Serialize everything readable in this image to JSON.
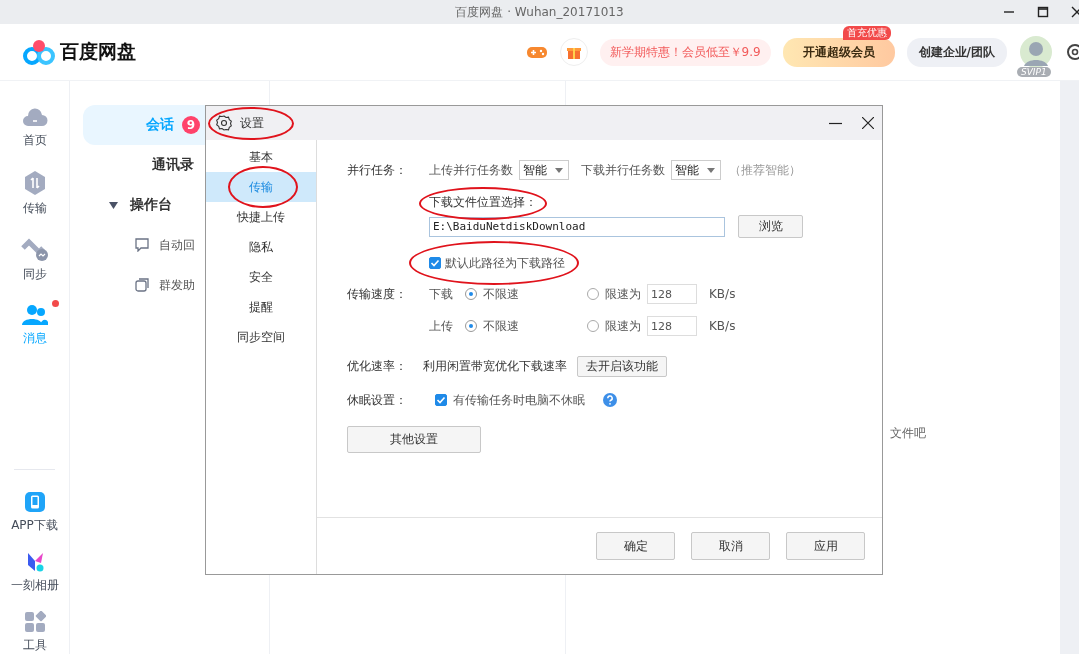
{
  "window": {
    "title": "百度网盘 · Wuhan_20171013"
  },
  "header": {
    "logo": "百度网盘",
    "promo": "新学期特惠！会员低至￥9.9",
    "vip_button": "开通超级会员",
    "vip_badge": "首充优惠",
    "team_button": "创建企业/团队",
    "avatar_badge": "SVIP1"
  },
  "nav": {
    "items": [
      {
        "kind": "home",
        "label": "首页",
        "selected": false,
        "notification": false
      },
      {
        "kind": "transfer",
        "label": "传输",
        "selected": false,
        "notification": false
      },
      {
        "kind": "sync",
        "label": "同步",
        "selected": false,
        "notification": false
      },
      {
        "kind": "message",
        "label": "消息",
        "selected": true,
        "notification": true
      }
    ],
    "bottom": [
      {
        "kind": "app",
        "label": "APP下载"
      },
      {
        "kind": "album",
        "label": "一刻相册"
      },
      {
        "kind": "tools",
        "label": "工具"
      }
    ]
  },
  "messages": {
    "items": [
      {
        "label": "会话",
        "selected": true,
        "badge": "9"
      },
      {
        "label": "通讯录",
        "selected": false
      },
      {
        "label": "操作台",
        "selected": false,
        "expanded": true,
        "children": [
          {
            "kind": "auto-reply",
            "label": "自动回"
          },
          {
            "kind": "broadcast",
            "label": "群发助"
          }
        ]
      }
    ]
  },
  "background_text": "文件吧",
  "dialog": {
    "title": "设置",
    "title_circled": true,
    "menu": [
      {
        "label": "基本",
        "selected": false,
        "circled": false
      },
      {
        "label": "传输",
        "selected": true,
        "circled": true
      },
      {
        "label": "快捷上传",
        "selected": false,
        "circled": false
      },
      {
        "label": "隐私",
        "selected": false,
        "circled": false
      },
      {
        "label": "安全",
        "selected": false,
        "circled": false
      },
      {
        "label": "提醒",
        "selected": false,
        "circled": false
      },
      {
        "label": "同步空间",
        "selected": false,
        "circled": false
      }
    ],
    "parallel": {
      "label": "并行任务：",
      "upload_label": "上传并行任务数",
      "upload_value": "智能",
      "download_label": "下载并行任务数",
      "download_value": "智能",
      "hint": "（推荐智能）"
    },
    "location": {
      "label": "下载文件位置选择：",
      "circled": true,
      "path": "E:\\BaiduNetdiskDownload",
      "browse": "浏览",
      "default": {
        "label": "默认此路径为下载路径",
        "checked": true,
        "circled": true
      }
    },
    "speed": {
      "label": "传输速度：",
      "rows": [
        {
          "direction": "下载",
          "options": [
            {
              "label": "不限速",
              "selected": true
            },
            {
              "label": "限速为",
              "selected": false
            }
          ],
          "limit": "128",
          "unit": "KB/s"
        },
        {
          "direction": "上传",
          "options": [
            {
              "label": "不限速",
              "selected": true
            },
            {
              "label": "限速为",
              "selected": false
            }
          ],
          "limit": "128",
          "unit": "KB/s"
        }
      ]
    },
    "optimize": {
      "label": "优化速率：",
      "text": "利用闲置带宽优化下载速率",
      "button": "去开启该功能"
    },
    "sleep": {
      "label": "休眠设置：",
      "checkbox": {
        "label": "有传输任务时电脑不休眠",
        "checked": true
      }
    },
    "other_button": "其他设置",
    "buttons": [
      "确定",
      "取消",
      "应用"
    ]
  }
}
